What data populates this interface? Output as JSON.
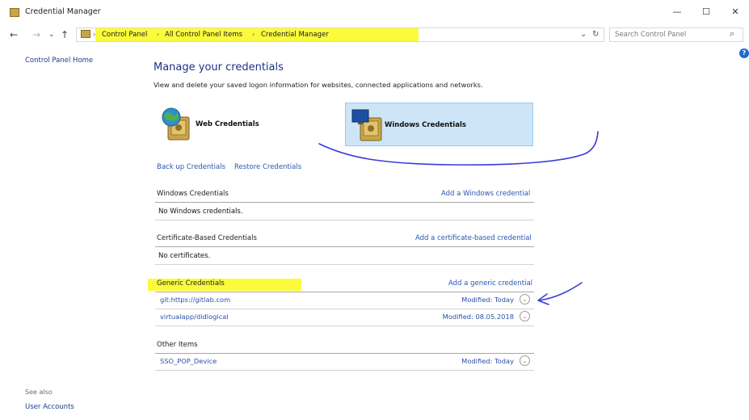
{
  "window": {
    "title": "Credential Manager",
    "controls": {
      "minimize": "—",
      "maximize": "☐",
      "close": "✕"
    }
  },
  "addressbar": {
    "back": "←",
    "forward": "→",
    "recent": "⌄",
    "up": "↑",
    "breadcrumbs": [
      "Control Panel",
      "All Control Panel Items",
      "Credential Manager"
    ],
    "separator": "›",
    "dropdown": "⌄",
    "refresh": "↻",
    "search_placeholder": "Search Control Panel",
    "search_icon": "⌕"
  },
  "sidebar": {
    "home_link": "Control Panel Home",
    "see_also_label": "See also",
    "see_also_links": [
      "User Accounts"
    ]
  },
  "help": {
    "glyph": "?"
  },
  "main": {
    "title": "Manage your credentials",
    "description": "View and delete your saved logon information for websites, connected applications and networks.",
    "tiles": {
      "web": {
        "label": "Web Credentials",
        "icon": "web-credentials-icon"
      },
      "windows": {
        "label": "Windows Credentials",
        "icon": "windows-credentials-icon",
        "selected": true
      }
    },
    "actions": {
      "backup": "Back up Credentials",
      "restore": "Restore Credentials"
    },
    "sections": {
      "windows": {
        "heading": "Windows Credentials",
        "add_link": "Add a Windows credential",
        "empty_text": "No Windows credentials."
      },
      "certificate": {
        "heading": "Certificate-Based Credentials",
        "add_link": "Add a certificate-based credential",
        "empty_text": "No certificates."
      },
      "generic": {
        "heading": "Generic Credentials",
        "add_link": "Add a generic credential",
        "items": [
          {
            "name": "git:https://gitlab.com",
            "modified": "Modified:  Today"
          },
          {
            "name": "virtualapp/didlogical",
            "modified": "Modified:  08.05.2018"
          }
        ]
      },
      "other": {
        "heading": "Other Items",
        "items": [
          {
            "name": "SSO_POP_Device",
            "modified": "Modified:  Today"
          }
        ]
      }
    },
    "expander_glyph": "⌄"
  },
  "colors": {
    "highlight": "#fbfb3c",
    "link": "#2a55b3",
    "title": "#1e3287",
    "selected_tile": "#cde5f7",
    "annotation_ink": "#3b3bd6"
  }
}
